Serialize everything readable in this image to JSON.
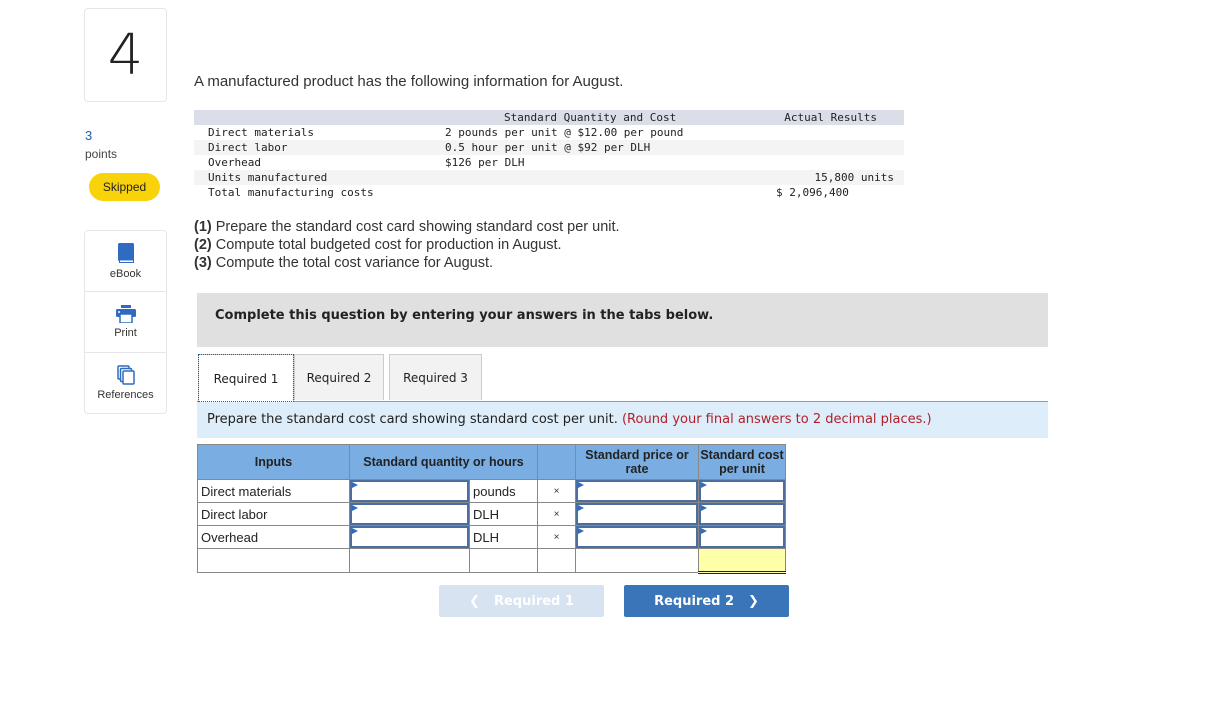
{
  "sidebar": {
    "question_number": "4",
    "points_value": "3",
    "points_label": "points",
    "status_badge": "Skipped",
    "status_color": "#f9d30a",
    "tools": [
      {
        "label": "eBook",
        "icon": "book-icon"
      },
      {
        "label": "Print",
        "icon": "printer-icon"
      },
      {
        "label": "References",
        "icon": "copy-icon"
      }
    ]
  },
  "question": {
    "intro": "A manufactured product has the following information for August.",
    "given_table": {
      "headers": {
        "standard": "Standard Quantity and Cost",
        "actual": "Actual Results"
      },
      "rows": [
        {
          "label": "Direct materials",
          "standard": "2 pounds per unit @ $12.00 per pound",
          "actual": ""
        },
        {
          "label": "Direct labor",
          "standard": "0.5 hour per unit @ $92 per DLH",
          "actual": ""
        },
        {
          "label": "Overhead",
          "standard": "$126 per DLH",
          "actual": ""
        },
        {
          "label": "Units manufactured",
          "standard": "",
          "actual": "15,800 units"
        },
        {
          "label": "Total manufacturing costs",
          "standard": "",
          "actual": "$ 2,096,400"
        }
      ]
    },
    "requirements": [
      {
        "num": "(1)",
        "text": " Prepare the standard cost card showing standard cost per unit."
      },
      {
        "num": "(2)",
        "text": " Compute total budgeted cost for production in August."
      },
      {
        "num": "(3)",
        "text": " Compute the total cost variance for August."
      }
    ]
  },
  "banner": "Complete this question by entering your answers in the tabs below.",
  "tabs": [
    {
      "label": "Required 1",
      "active": true
    },
    {
      "label": "Required 2",
      "active": false
    },
    {
      "label": "Required 3",
      "active": false
    }
  ],
  "instruction": {
    "text": "Prepare the standard cost card showing standard cost per unit.",
    "note": "(Round your final answers to 2 decimal places.)"
  },
  "cost_card": {
    "headers": {
      "inputs": "Inputs",
      "quantity": "Standard quantity or hours",
      "price": "Standard price or rate",
      "cost": "Standard cost per unit"
    },
    "rows": [
      {
        "label": "Direct materials",
        "quantity": "",
        "unit": "pounds",
        "times": "×",
        "price": "",
        "cost": ""
      },
      {
        "label": "Direct labor",
        "quantity": "",
        "unit": "DLH",
        "times": "×",
        "price": "",
        "cost": ""
      },
      {
        "label": "Overhead",
        "quantity": "",
        "unit": "DLH",
        "times": "×",
        "price": "",
        "cost": ""
      }
    ],
    "total_cost": ""
  },
  "navigation": {
    "prev_label": "Required 1",
    "next_label": "Required 2",
    "prev_icon": "chevron-left-icon",
    "next_icon": "chevron-right-icon"
  }
}
